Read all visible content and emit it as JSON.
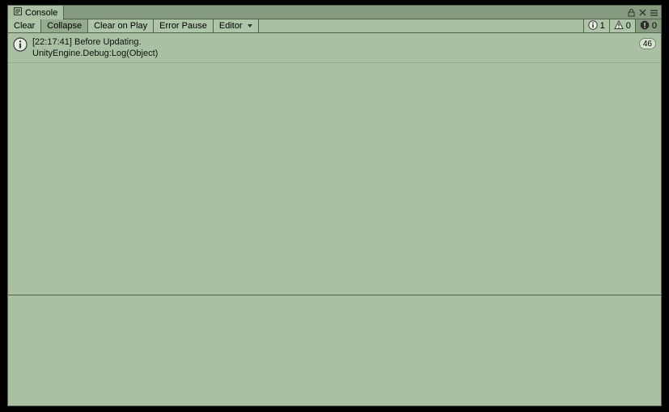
{
  "tab": {
    "title": "Console"
  },
  "toolbar": {
    "clear_label": "Clear",
    "collapse_label": "Collapse",
    "clear_on_play_label": "Clear on Play",
    "error_pause_label": "Error Pause",
    "editor_label": "Editor"
  },
  "counters": {
    "info": "1",
    "warning": "0",
    "error": "0"
  },
  "log": {
    "entries": [
      {
        "line1": "[22:17:41] Before Updating.",
        "line2": "UnityEngine.Debug:Log(Object)",
        "count": "46"
      }
    ]
  }
}
